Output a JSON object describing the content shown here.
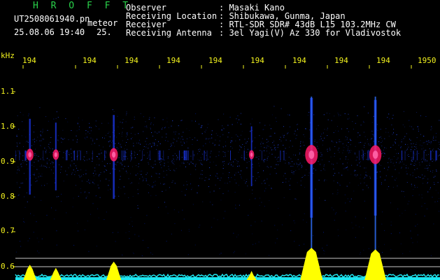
{
  "header": {
    "app_name": "H R O F F T",
    "filename": "UT2508061940.pn",
    "file_tag": "meteor",
    "date_time": "25.08.06 19:40",
    "extra": "25.",
    "labels": {
      "observer": "Observer",
      "location": "Receiving Location",
      "receiver": "Receiver",
      "antenna": "Receiving Antenna"
    },
    "values": {
      "observer": ": Masaki Kano",
      "location": ": Shibukawa, Gunma, Japan",
      "receiver": ": RTL-SDR SDR# 43dB L15 103.2MHz CW",
      "antenna": ": 3el Yagi(V) Az 330 for Vladivostok"
    }
  },
  "axes": {
    "y_unit": "kHz",
    "y_ticks": [
      "1.1",
      "1.0",
      "0.9",
      "0.8",
      "0.7",
      "0.6"
    ],
    "x_ticks": [
      "194",
      "194",
      "194",
      "194",
      "194",
      "194",
      "194",
      "194",
      "194",
      "1950"
    ]
  },
  "colors": {
    "text": "#ffffff",
    "tick": "#f2f21e",
    "brand": "#29d24a",
    "waterfall_bg": "#000000",
    "signal_blue": "#1e3cff",
    "signal_peak": "#ff1a66",
    "amplitude_cyan": "#1ee6f0",
    "amplitude_peak": "#ffff00"
  },
  "chart_data": {
    "type": "heatmap",
    "title": "",
    "xlabel": "",
    "ylabel": "kHz",
    "x_ticks": [
      "194",
      "194",
      "194",
      "194",
      "194",
      "194",
      "194",
      "194",
      "194",
      "1950"
    ],
    "y_ticks": [
      "1.1",
      "1.0",
      "0.9",
      "0.8",
      "0.7",
      "0.6"
    ],
    "ylim": [
      0.58,
      1.16
    ],
    "carrier_khz": 0.92,
    "meteor_echoes": [
      {
        "x_minute": 1940.1,
        "strength": 0.45
      },
      {
        "x_minute": 1940.75,
        "strength": 0.35
      },
      {
        "x_minute": 1942.2,
        "strength": 0.55
      },
      {
        "x_minute": 1945.65,
        "strength": 0.25
      },
      {
        "x_minute": 1947.15,
        "strength": 1.0
      },
      {
        "x_minute": 1948.75,
        "strength": 0.95
      }
    ]
  }
}
